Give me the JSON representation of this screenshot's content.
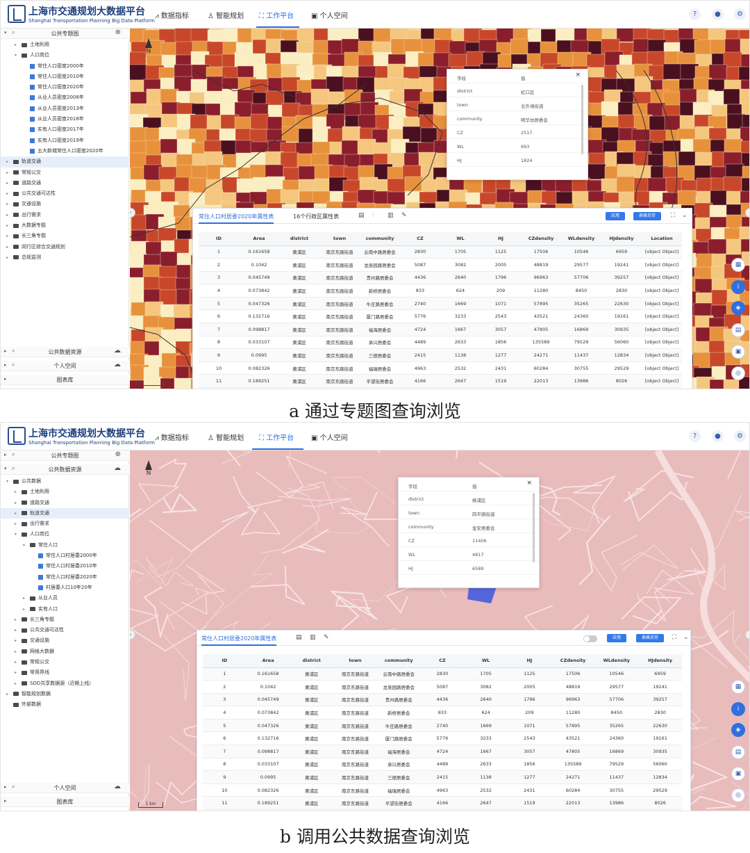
{
  "header": {
    "title_cn": "上海市交通规划大数据平台",
    "title_en": "Shanghai Transportation Planning Big Data Platform",
    "nav": [
      {
        "label": "数据指标"
      },
      {
        "label": "智能规划"
      },
      {
        "label": "工作平台"
      },
      {
        "label": "个人空间"
      }
    ],
    "icons": [
      "help-icon",
      "user-icon",
      "settings-icon"
    ]
  },
  "panel_a": {
    "caption": "a 通过专题图查询浏览",
    "sidebar_top": {
      "label": "公共专题图"
    },
    "tree": [
      {
        "label": "土地利用",
        "level": 1,
        "type": "folder",
        "toggle": "▸"
      },
      {
        "label": "人口岗位",
        "level": 1,
        "type": "folder",
        "toggle": "▾"
      },
      {
        "label": "常住人口密度2000年",
        "level": 2,
        "type": "layer"
      },
      {
        "label": "常住人口密度2010年",
        "level": 2,
        "type": "layer"
      },
      {
        "label": "常住人口密度2020年",
        "level": 2,
        "type": "layer"
      },
      {
        "label": "从业人员密度2008年",
        "level": 2,
        "type": "layer"
      },
      {
        "label": "从业人员密度2013年",
        "level": 2,
        "type": "layer"
      },
      {
        "label": "从业人员密度2018年",
        "level": 2,
        "type": "layer"
      },
      {
        "label": "实有人口密度2017年",
        "level": 2,
        "type": "layer"
      },
      {
        "label": "实有人口密度2019年",
        "level": 2,
        "type": "layer"
      },
      {
        "label": "五大新城常住人口密度2020年",
        "level": 2,
        "type": "layer"
      },
      {
        "label": "轨道交通",
        "level": 0,
        "type": "folder",
        "toggle": "▸",
        "selected": true
      },
      {
        "label": "常规公交",
        "level": 0,
        "type": "folder",
        "toggle": "▸"
      },
      {
        "label": "道路交通",
        "level": 0,
        "type": "folder",
        "toggle": "▸"
      },
      {
        "label": "公共交通可达性",
        "level": 0,
        "type": "folder",
        "toggle": "▸"
      },
      {
        "label": "交通设施",
        "level": 0,
        "type": "folder",
        "toggle": "▸"
      },
      {
        "label": "出行需求",
        "level": 0,
        "type": "folder",
        "toggle": "▸"
      },
      {
        "label": "大数据专题",
        "level": 0,
        "type": "folder",
        "toggle": "▸"
      },
      {
        "label": "长三角专题",
        "level": 0,
        "type": "folder",
        "toggle": "▸"
      },
      {
        "label": "闵行区综合交通规划",
        "level": 0,
        "type": "folder",
        "toggle": "▸"
      },
      {
        "label": "总规监测",
        "level": 0,
        "type": "folder",
        "toggle": "▸"
      }
    ],
    "sidebar_bottom": [
      {
        "label": "公共数据资源"
      },
      {
        "label": "个人空间"
      },
      {
        "label": "图表库"
      }
    ],
    "popup": {
      "close": "×",
      "rows": [
        {
          "k": "字段",
          "v": "值"
        },
        {
          "k": "district",
          "v": "虹口区"
        },
        {
          "k": "town",
          "v": "北外滩街道"
        },
        {
          "k": "community",
          "v": "明华坊居委会"
        },
        {
          "k": "CZ",
          "v": "2517"
        },
        {
          "k": "WL",
          "v": "693"
        },
        {
          "k": "HJ",
          "v": "1824"
        }
      ]
    },
    "table_panel": {
      "tabs": [
        "常住人口村居委2020年属性表",
        "16个行政区属性表"
      ],
      "btn_apply": "应用",
      "btn_save": "表格另存"
    },
    "table": {
      "columns": [
        "ID",
        "Area",
        "district",
        "town",
        "community",
        "CZ",
        "WL",
        "HJ",
        "CZdensity",
        "WLdensity",
        "HJdensity",
        "Location"
      ],
      "rows": [
        [
          "1",
          "0.161658",
          "黄浦区",
          "南京东路街道",
          "云南中路居委会",
          "2830",
          "1705",
          "1125",
          "17506",
          "10546",
          "6959",
          "[object Object]"
        ],
        [
          "2",
          "0.1042",
          "黄浦区",
          "南京东路街道",
          "龙泉园路居委会",
          "5087",
          "3082",
          "2005",
          "48819",
          "29577",
          "19241",
          "[object Object]"
        ],
        [
          "3",
          "0.045749",
          "黄浦区",
          "南京东路街道",
          "贵州路居委会",
          "4436",
          "2640",
          "1796",
          "96963",
          "57706",
          "39257",
          "[object Object]"
        ],
        [
          "4",
          "0.073842",
          "黄浦区",
          "南京东路街道",
          "新桥居委会",
          "833",
          "624",
          "209",
          "11280",
          "8450",
          "2830",
          "[object Object]"
        ],
        [
          "5",
          "0.047326",
          "黄浦区",
          "南京东路街道",
          "牛庄路居委会",
          "2740",
          "1669",
          "1071",
          "57895",
          "35265",
          "22630",
          "[object Object]"
        ],
        [
          "6",
          "0.132716",
          "黄浦区",
          "南京东路街道",
          "厦门路居委会",
          "5776",
          "3233",
          "2543",
          "43521",
          "24360",
          "19161",
          "[object Object]"
        ],
        [
          "7",
          "0.098817",
          "黄浦区",
          "南京东路街道",
          "福海居委会",
          "4724",
          "1667",
          "3057",
          "47805",
          "16869",
          "30935",
          "[object Object]"
        ],
        [
          "8",
          "0.033107",
          "黄浦区",
          "南京东路街道",
          "承兴居委会",
          "4489",
          "2633",
          "1856",
          "135589",
          "79529",
          "56060",
          "[object Object]"
        ],
        [
          "9",
          "0.0995",
          "黄浦区",
          "南京东路街道",
          "三德居委会",
          "2415",
          "1138",
          "1277",
          "24271",
          "11437",
          "12834",
          "[object Object]"
        ],
        [
          "10",
          "0.082326",
          "黄浦区",
          "南京东路街道",
          "福瑞居委会",
          "4963",
          "2532",
          "2431",
          "60284",
          "30755",
          "29529",
          "[object Object]"
        ],
        [
          "11",
          "0.189251",
          "黄浦区",
          "南京东路街道",
          "平望街居委会",
          "4166",
          "2647",
          "1519",
          "22013",
          "13986",
          "8026",
          "[object Object]"
        ]
      ]
    }
  },
  "panel_b": {
    "caption": "b 调用公共数据查询浏览",
    "sidebar_top": [
      {
        "label": "公共专题图"
      },
      {
        "label": "公共数据资源"
      }
    ],
    "tree": [
      {
        "label": "公共数据",
        "level": 0,
        "type": "folder",
        "toggle": "▾"
      },
      {
        "label": "土地利用",
        "level": 1,
        "type": "folder",
        "toggle": "▸"
      },
      {
        "label": "道路交通",
        "level": 1,
        "type": "folder",
        "toggle": "▸"
      },
      {
        "label": "轨道交通",
        "level": 1,
        "type": "folder",
        "toggle": "▸",
        "selected": true
      },
      {
        "label": "出行需求",
        "level": 1,
        "type": "folder",
        "toggle": "▸"
      },
      {
        "label": "人口岗位",
        "level": 1,
        "type": "folder",
        "toggle": "▾"
      },
      {
        "label": "常住人口",
        "level": 2,
        "type": "folder",
        "toggle": "▾"
      },
      {
        "label": "常住人口村居委2000年",
        "level": 3,
        "type": "layer"
      },
      {
        "label": "常住人口村居委2010年",
        "level": 3,
        "type": "layer"
      },
      {
        "label": "常住人口村居委2020年",
        "level": 3,
        "type": "layer"
      },
      {
        "label": "村居委人口10年20年",
        "level": 3,
        "type": "layer"
      },
      {
        "label": "从业人员",
        "level": 2,
        "type": "folder",
        "toggle": "▸"
      },
      {
        "label": "实有人口",
        "level": 2,
        "type": "folder",
        "toggle": "▸"
      },
      {
        "label": "长三角专题",
        "level": 1,
        "type": "folder",
        "toggle": "▸"
      },
      {
        "label": "公共交通可达性",
        "level": 1,
        "type": "folder",
        "toggle": "▸"
      },
      {
        "label": "交通设施",
        "level": 1,
        "type": "folder",
        "toggle": "▸"
      },
      {
        "label": "网格大数据",
        "level": 1,
        "type": "folder",
        "toggle": "▸"
      },
      {
        "label": "常规公交",
        "level": 1,
        "type": "folder",
        "toggle": "▸"
      },
      {
        "label": "常用界线",
        "level": 1,
        "type": "folder",
        "toggle": "▸"
      },
      {
        "label": "SDD共享数据源（近期上线）",
        "level": 1,
        "type": "folder",
        "toggle": "▸"
      },
      {
        "label": "智能规划数据",
        "level": 0,
        "type": "folder",
        "toggle": "▸"
      },
      {
        "label": "外部数据",
        "level": 0,
        "type": "folder",
        "toggle": ""
      }
    ],
    "sidebar_bottom": [
      {
        "label": "个人空间"
      },
      {
        "label": "图表库"
      }
    ],
    "scale": "1 km",
    "popup": {
      "close": "×",
      "rows": [
        {
          "k": "字段",
          "v": "值"
        },
        {
          "k": "district",
          "v": "杨浦区"
        },
        {
          "k": "town",
          "v": "四平路街道"
        },
        {
          "k": "community",
          "v": "金安居委会"
        },
        {
          "k": "CZ",
          "v": "11406"
        },
        {
          "k": "WL",
          "v": "4817"
        },
        {
          "k": "HJ",
          "v": "6589"
        }
      ]
    },
    "table_panel": {
      "tabs": [
        "常住人口村居委2020年属性表"
      ],
      "btn_apply": "应用",
      "btn_save": "表格另存"
    },
    "table": {
      "columns": [
        "ID",
        "Area",
        "district",
        "town",
        "community",
        "CZ",
        "WL",
        "HJ",
        "CZdensity",
        "WLdensity",
        "HJdensity"
      ],
      "rows": [
        [
          "1",
          "0.161658",
          "黄浦区",
          "南京东路街道",
          "云南中路居委会",
          "2830",
          "1705",
          "1125",
          "17506",
          "10546",
          "6959"
        ],
        [
          "2",
          "0.1042",
          "黄浦区",
          "南京东路街道",
          "龙泉园路居委会",
          "5087",
          "3082",
          "2005",
          "48819",
          "29577",
          "19241"
        ],
        [
          "3",
          "0.045749",
          "黄浦区",
          "南京东路街道",
          "贵州路居委会",
          "4436",
          "2640",
          "1796",
          "96963",
          "57706",
          "39257"
        ],
        [
          "4",
          "0.073842",
          "黄浦区",
          "南京东路街道",
          "新桥居委会",
          "833",
          "624",
          "209",
          "11280",
          "8450",
          "2830"
        ],
        [
          "5",
          "0.047326",
          "黄浦区",
          "南京东路街道",
          "牛庄路居委会",
          "2740",
          "1669",
          "1071",
          "57895",
          "35265",
          "22630"
        ],
        [
          "6",
          "0.132716",
          "黄浦区",
          "南京东路街道",
          "厦门路居委会",
          "5776",
          "3233",
          "2543",
          "43521",
          "24360",
          "19161"
        ],
        [
          "7",
          "0.098817",
          "黄浦区",
          "南京东路街道",
          "福海居委会",
          "4724",
          "1667",
          "3057",
          "47805",
          "16869",
          "30935"
        ],
        [
          "8",
          "0.033107",
          "黄浦区",
          "南京东路街道",
          "承兴居委会",
          "4489",
          "2633",
          "1856",
          "135589",
          "79529",
          "56060"
        ],
        [
          "9",
          "0.0995",
          "黄浦区",
          "南京东路街道",
          "三德居委会",
          "2415",
          "1138",
          "1277",
          "24271",
          "11437",
          "12834"
        ],
        [
          "10",
          "0.082326",
          "黄浦区",
          "南京东路街道",
          "福瑞居委会",
          "4963",
          "2532",
          "2431",
          "60284",
          "30755",
          "29529"
        ],
        [
          "11",
          "0.189251",
          "黄浦区",
          "南京东路街道",
          "平望街居委会",
          "4166",
          "2647",
          "1519",
          "22013",
          "13986",
          "8026"
        ]
      ]
    }
  },
  "colors": {
    "accent": "#2d6de0",
    "brand": "#1c3f7c",
    "density_palette": [
      "#fbeec2",
      "#f5c77e",
      "#e8913c",
      "#c8472a",
      "#8b1e2c",
      "#4a1020"
    ],
    "basemap_b": "#e9bcbc"
  }
}
